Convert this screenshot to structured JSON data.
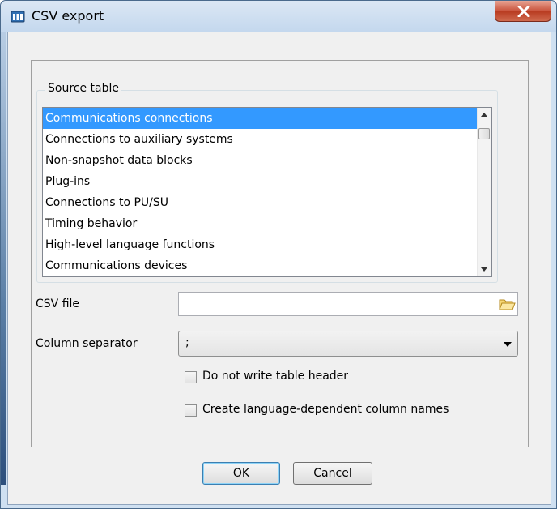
{
  "window": {
    "title": "CSV export",
    "icon": "app-icon",
    "close_icon": "close-x-icon"
  },
  "source_table": {
    "label": "Source table",
    "items": [
      "Communications connections",
      "Connections to auxiliary systems",
      "Non-snapshot data blocks",
      "Plug-ins",
      "Connections to PU/SU",
      "Timing behavior",
      "High-level language functions",
      "Communications devices"
    ],
    "selected_index": 0
  },
  "csv_file": {
    "label": "CSV file",
    "value": "",
    "browse_icon": "folder-open-icon"
  },
  "column_separator": {
    "label": "Column separator",
    "value": ";"
  },
  "options": {
    "no_header_label": "Do not write table header",
    "no_header_checked": false,
    "lang_columns_label": "Create language-dependent column names",
    "lang_columns_checked": false
  },
  "buttons": {
    "ok": "OK",
    "cancel": "Cancel"
  },
  "colors": {
    "selection": "#3399ff",
    "close_button": "#c9533c"
  }
}
